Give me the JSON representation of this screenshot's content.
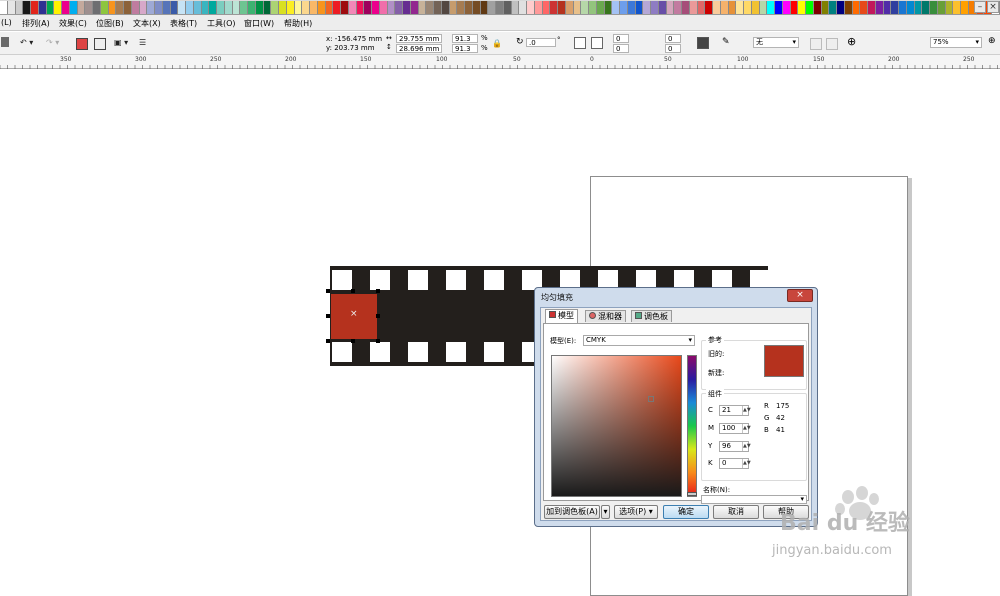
{
  "palette": {
    "colors": [
      "#ffffff",
      "#e6e6e6",
      "#cccccc",
      "#1a1a1a",
      "#e1251b",
      "#2e3192",
      "#00a651",
      "#fff200",
      "#ec008c",
      "#00aeef",
      "#c4a99d",
      "#9e8f8f",
      "#6d6e71",
      "#8dc63f",
      "#f7941d",
      "#a67c52",
      "#8c6239",
      "#bf7c9f",
      "#d7a8c9",
      "#9ea9d5",
      "#7f8dc6",
      "#5674b9",
      "#3a5ba9",
      "#c6e3f5",
      "#94cdee",
      "#67bdd9",
      "#3ab5c0",
      "#00a99d",
      "#7bcdbf",
      "#a1d9cc",
      "#bce4d5",
      "#6ec591",
      "#3cb371",
      "#009245",
      "#006837",
      "#acd373",
      "#d9e021",
      "#fcee21",
      "#fff799",
      "#fbd78e",
      "#f9b868",
      "#f7941d",
      "#f26522",
      "#ed1c24",
      "#9e0b0f",
      "#f287b7",
      "#ed145b",
      "#9e005d",
      "#ec008c",
      "#f06eaa",
      "#b18fc6",
      "#8560a8",
      "#662d91",
      "#92278f",
      "#c7b299",
      "#998675",
      "#736357",
      "#534741",
      "#c69c6d",
      "#a67c52",
      "#8c6239",
      "#754c24",
      "#603913",
      "#a0a0a0",
      "#808080",
      "#606060",
      "#c0c0c0",
      "#e0e0e0",
      "#ffcccc",
      "#ff9999",
      "#ff6666",
      "#cc3333",
      "#b5321e",
      "#d9a06b",
      "#e8c08a",
      "#b6d7a8",
      "#93c47d",
      "#6aa84f",
      "#38761d",
      "#a4c2f4",
      "#6d9eeb",
      "#3c78d8",
      "#1155cc",
      "#b4a7d6",
      "#8e7cc3",
      "#674ea7",
      "#d5a6bd",
      "#c27ba0",
      "#a64d79",
      "#ea9999",
      "#e06666",
      "#cc0000",
      "#f9cb9c",
      "#f6b26b",
      "#e69138",
      "#ffe599",
      "#ffd966",
      "#f1c232",
      "#b6d7a8",
      "#00ffff",
      "#0000ff",
      "#ff00ff",
      "#ff0000",
      "#ffff00",
      "#00ff00",
      "#800000",
      "#808000",
      "#008080",
      "#000080",
      "#7f3f00",
      "#ff6a00",
      "#e64a19",
      "#c2185b",
      "#7b1fa2",
      "#512da8",
      "#303f9f",
      "#1976d2",
      "#0288d1",
      "#0097a7",
      "#00796b",
      "#388e3c",
      "#689f38",
      "#afb42b",
      "#fbc02d",
      "#ffa000",
      "#f57c00",
      "#e64a19",
      "#ff4500",
      "#ffffff"
    ],
    "minimize_label": "–",
    "close_label": "×"
  },
  "menu": [
    "(L)",
    "排列(A)",
    "效果(C)",
    "位图(B)",
    "文本(X)",
    "表格(T)",
    "工具(O)",
    "窗口(W)",
    "帮助(H)"
  ],
  "propbar": {
    "x": "x: -156.475 mm",
    "y": "y: 203.73 mm",
    "width": "29.755 mm",
    "height": "28.696 mm",
    "scale_x": "91.3",
    "scale_y": "91.3",
    "percent": "%",
    "rotation": ".0",
    "degree": "°",
    "corner_values": [
      "0",
      "0",
      "0",
      "0"
    ],
    "outline": "无",
    "zoom": "75%"
  },
  "ruler": {
    "labels": [
      "350",
      "300",
      "250",
      "200",
      "150",
      "100",
      "50",
      "0",
      "50",
      "100",
      "150",
      "200",
      "250"
    ]
  },
  "dialog": {
    "title": "均匀填充",
    "close": "×",
    "tabs": [
      "模型",
      "混和器",
      "调色板"
    ],
    "model_label": "模型(E):",
    "model_value": "CMYK",
    "reference_title": "参考",
    "old_label": "旧的:",
    "new_label": "新建:",
    "components_title": "组件",
    "cmyk": [
      {
        "label": "C",
        "value": "21"
      },
      {
        "label": "M",
        "value": "100"
      },
      {
        "label": "Y",
        "value": "96"
      },
      {
        "label": "K",
        "value": "0"
      }
    ],
    "rgb": [
      {
        "label": "R",
        "value": "175"
      },
      {
        "label": "G",
        "value": "42"
      },
      {
        "label": "B",
        "value": "41"
      }
    ],
    "name_label": "名称(N):",
    "name_value": "",
    "add_palette_button": "加到调色板(A)",
    "options_button": "选项(P)",
    "ok_button": "确定",
    "cancel_button": "取消",
    "help_button": "帮助",
    "swatch_color": "#b5321e"
  },
  "watermark": {
    "brand": "Bai du 经验",
    "url": "jingyan.baidu.com"
  }
}
